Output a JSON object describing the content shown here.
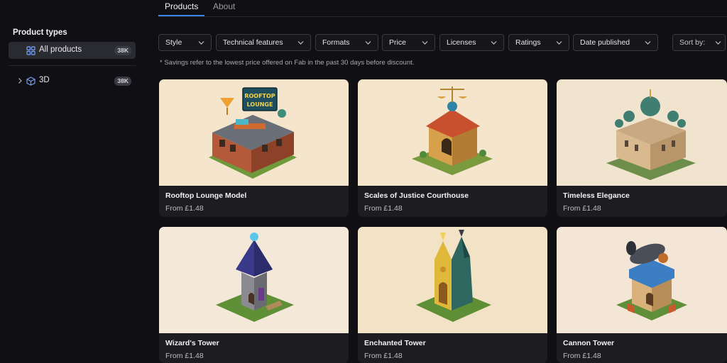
{
  "tabs": [
    {
      "label": "Products",
      "active": true
    },
    {
      "label": "About",
      "active": false
    }
  ],
  "sidebar": {
    "title": "Product types",
    "items": [
      {
        "label": "All products",
        "count": "38K",
        "icon": "grid-icon",
        "active": true
      },
      {
        "label": "3D",
        "count": "38K",
        "icon": "cube-icon",
        "active": false
      }
    ]
  },
  "filters": [
    {
      "label": "Style"
    },
    {
      "label": "Technical features"
    },
    {
      "label": "Formats"
    },
    {
      "label": "Price"
    },
    {
      "label": "Licenses"
    },
    {
      "label": "Ratings"
    },
    {
      "label": "Date published"
    }
  ],
  "sort": {
    "label": "Sort by:"
  },
  "note": "* Savings refer to the lowest price offered on Fab in the past 30 days before discount.",
  "products": [
    {
      "title": "Rooftop Lounge Model",
      "price": "From £1.48",
      "sign": "ROOFTOP",
      "sign2": "LOUNGE"
    },
    {
      "title": "Scales of Justice Courthouse",
      "price": "From £1.48"
    },
    {
      "title": "Timeless Elegance",
      "price": "From £1.48"
    },
    {
      "title": "Wizard's Tower",
      "price": "From £1.48"
    },
    {
      "title": "Enchanted Tower",
      "price": "From £1.48"
    },
    {
      "title": "Cannon Tower",
      "price": "From £1.48"
    }
  ],
  "colors": {
    "accent": "#3a86f7",
    "background": "#101014",
    "card": "#1c1c21",
    "thumbnail_bg": "#f3e6cf"
  }
}
